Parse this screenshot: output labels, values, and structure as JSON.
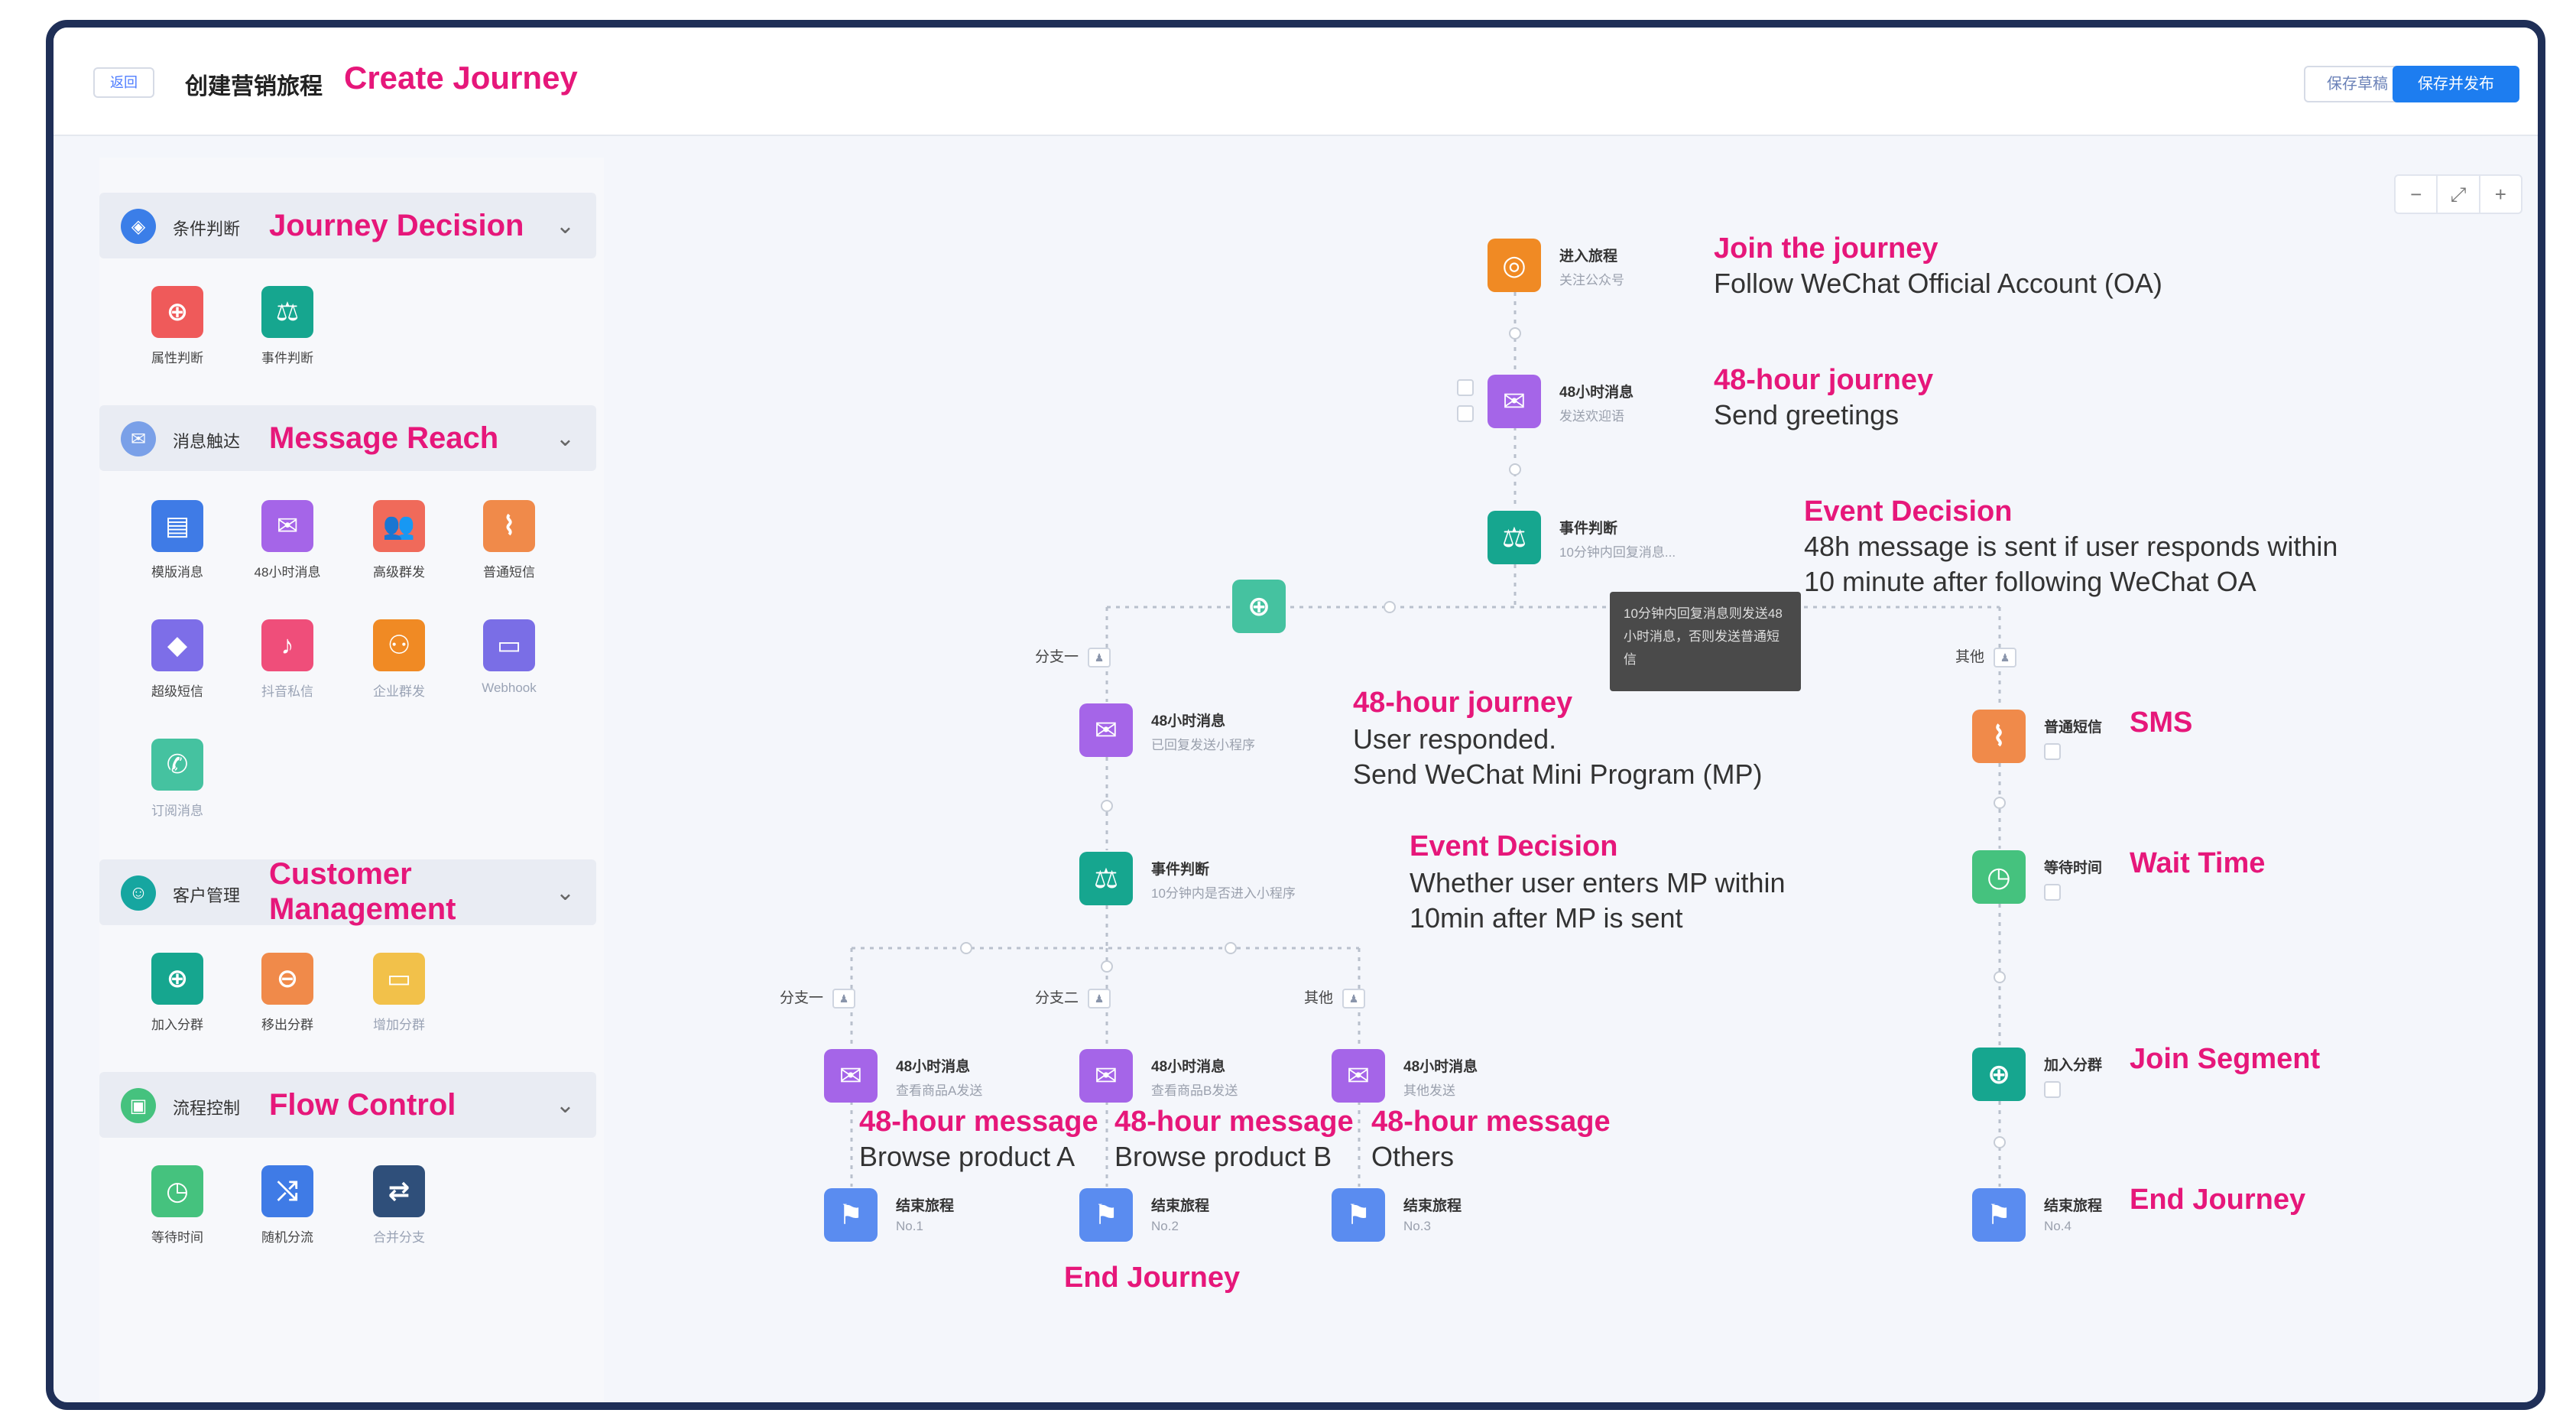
{
  "header": {
    "back_label": "返回",
    "title_cn": "创建营销旅程",
    "title_en": "Create Journey",
    "save_draft": "保存草稿",
    "save_publish": "保存并发布"
  },
  "sidebar": {
    "sections": [
      {
        "cn": "条件判断",
        "en": "Journey Decision",
        "tools": [
          "属性判断",
          "事件判断"
        ]
      },
      {
        "cn": "消息触达",
        "en": "Message Reach",
        "tools": [
          "模版消息",
          "48小时消息",
          "高级群发",
          "普通短信",
          "超级短信",
          "抖音私信",
          "企业群发",
          "Webhook",
          "订阅消息"
        ]
      },
      {
        "cn": "客户管理",
        "en": "Customer Management",
        "tools": [
          "加入分群",
          "移出分群",
          "增加分群"
        ]
      },
      {
        "cn": "流程控制",
        "en": "Flow Control",
        "tools": [
          "等待时间",
          "随机分流",
          "合并分支"
        ]
      }
    ]
  },
  "zoom": {
    "minus": "−",
    "fit": "⤢",
    "plus": "+"
  },
  "nodes": {
    "join": {
      "type": "进入旅程",
      "sub": "关注公众号",
      "en_title": "Join the journey",
      "en_desc": "Follow WeChat Official Account (OA)"
    },
    "msg1": {
      "type": "48小时消息",
      "sub": "发送欢迎语",
      "en_title": "48-hour journey",
      "en_desc": "Send greetings"
    },
    "event1": {
      "type": "事件判断",
      "sub": "10分钟内回复消息...",
      "en_title": "Event Decision",
      "en_desc1": "48h message is sent if user responds within",
      "en_desc2": "10 minute after following WeChat OA"
    },
    "tooltip": "10分钟内回复消息则发送48小时消息，否则发送普通短信",
    "branch1": "分支一",
    "other1": "其他",
    "msg2": {
      "type": "48小时消息",
      "sub": "已回复发送小程序",
      "en_title": "48-hour journey",
      "en_desc1": "User responded.",
      "en_desc2": "Send WeChat Mini Program (MP)"
    },
    "event2": {
      "type": "事件判断",
      "sub": "10分钟内是否进入小程序",
      "en_title": "Event Decision",
      "en_desc1": "Whether user enters MP within",
      "en_desc2": "10min after MP is sent"
    },
    "b_a": "分支一",
    "b_b": "分支二",
    "b_other": "其他",
    "msgA": {
      "type": "48小时消息",
      "sub": "查看商品A发送",
      "en_title": "48-hour message",
      "en_desc": "Browse product A"
    },
    "msgB": {
      "type": "48小时消息",
      "sub": "查看商品B发送",
      "en_title": "48-hour message",
      "en_desc": "Browse product B"
    },
    "msgC": {
      "type": "48小时消息",
      "sub": "其他发送",
      "en_title": "48-hour message",
      "en_desc": "Others"
    },
    "end1": {
      "type": "结束旅程",
      "sub": "No.1"
    },
    "end2": {
      "type": "结束旅程",
      "sub": "No.2"
    },
    "end3": {
      "type": "结束旅程",
      "sub": "No.3"
    },
    "end_label": "End Journey",
    "sms": {
      "type": "普通短信",
      "en_title": "SMS"
    },
    "wait": {
      "type": "等待时间",
      "en_title": "Wait Time"
    },
    "segment": {
      "type": "加入分群",
      "en_title": "Join Segment"
    },
    "end4": {
      "type": "结束旅程",
      "sub": "No.4",
      "en_title": "End Journey"
    }
  },
  "colors": {
    "accent_pink": "#e6177a",
    "primary_blue": "#1d7df0",
    "orange": "#f08a24",
    "purple": "#a565e8",
    "teal": "#16a68f",
    "green": "#45c27e",
    "blue_flag": "#5a8cf0"
  },
  "icons": [
    "globe-icon",
    "scale-icon",
    "envelope-icon",
    "template-icon",
    "users-icon",
    "antenna-icon",
    "diamond-icon",
    "tiktok-icon",
    "group-icon",
    "monitor-icon",
    "chat-icon",
    "user-plus-icon",
    "user-minus-icon",
    "folder-icon",
    "timer-icon",
    "shuffle-icon",
    "merge-icon",
    "flag-icon",
    "target-icon"
  ]
}
